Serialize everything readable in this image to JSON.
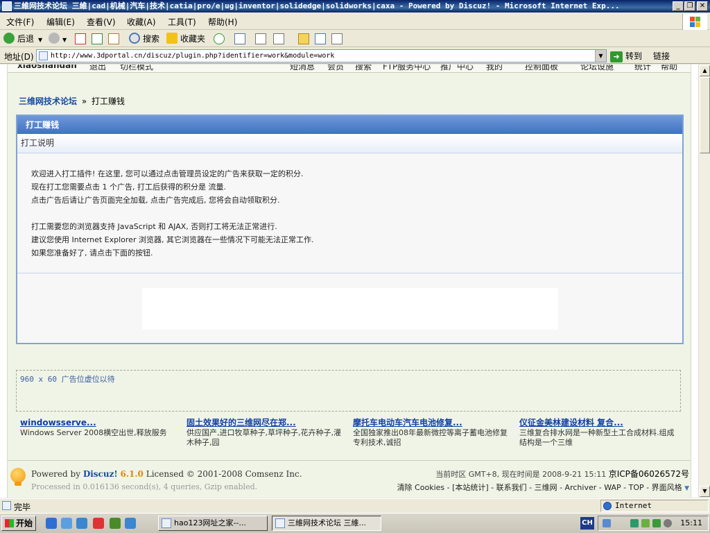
{
  "window": {
    "title": "三維网技术论坛 三維|cad|机械|汽车|技术|catia|pro/e|ug|inventor|solidedge|solidworks|caxa - Powered by Discuz! - Microsoft Internet Exp...",
    "minimize": "_",
    "maximize": "❐",
    "close": "✕"
  },
  "menu": [
    "文件(F)",
    "编辑(E)",
    "查看(V)",
    "收藏(A)",
    "工具(T)",
    "帮助(H)"
  ],
  "toolbar": {
    "back": "后退",
    "search": "搜索",
    "favorites": "收藏夹"
  },
  "address": {
    "label": "地址(D)",
    "url": "http://www.3dportal.cn/discuz/plugin.php?identifier=work&module=work",
    "go": "转到",
    "links": "链接"
  },
  "topnav": {
    "user": "xiaoshandan",
    "logout": "退出",
    "mode": "切栏模式",
    "items": [
      "短消息",
      "会员",
      "搜索",
      "FTP服务中心",
      "推广中心",
      "我的",
      "控制面板",
      "论坛设施",
      "统计",
      "帮助"
    ]
  },
  "breadcrumb": {
    "home": "三维网技术论坛",
    "sep": "»",
    "current": "打工赚钱"
  },
  "panel": {
    "title": "打工赚钱",
    "subtitle": "打工说明",
    "lines": [
      "欢迎进入打工插件! 在这里, 您可以通过点击管理员设定的广告来获取一定的积分.",
      "现在打工您需要点击 1 个广告, 打工后获得的积分是 流量.",
      "点击广告后请让广告页面完全加载, 点击广告完成后, 您将会自动领取积分.",
      "",
      "打工需要您的浏览器支持 JavaScript 和 AJAX, 否则打工将无法正常进行.",
      "建议您使用 Internet Explorer 浏览器, 其它浏览器在一些情况下可能无法正常工作.",
      "如果您准备好了, 请点击下面的按钮."
    ]
  },
  "banner_placeholder": "960 x 60 广告位虚位以待",
  "ads": [
    {
      "title": "windowsserve...",
      "desc": "Windows Server 2008横空出世,释放服务"
    },
    {
      "title": "固土效果好的三维网尽在郑...",
      "desc": "供应国产,进口牧草种子,草坪种子,花卉种子,灌木种子,园"
    },
    {
      "title": "摩托车电动车汽车电池修复...",
      "desc": "全国独家推出08年最新微控等离子蓄电池修复专利技术,诚招"
    },
    {
      "title": "仪征金美林建设材料 复合...",
      "desc": "三维复合排水网是一种新型土工合成材料.组成结构是一个三维"
    }
  ],
  "footer": {
    "powered_by": "Powered by",
    "brand": "Discuz!",
    "version": "6.1.0",
    "license": "Licensed © 2001-2008 Comsenz Inc.",
    "processed": "Processed in 0.016136 second(s), 4 queries, Gzip enabled.",
    "timezone": "当前时区 GMT+8, 现在时间是 2008-9-21 15:11",
    "icp": "京ICP备06026572号",
    "links": "清除 Cookies - [本站统计] - 联系我们 - 三维网 - Archiver - WAP - TOP - 界面风格"
  },
  "status": {
    "text": "完毕",
    "zone": "Internet"
  },
  "taskbar": {
    "start": "开始",
    "tasks": [
      "hao123网址之家--...",
      "三維网技术论坛 三維..."
    ],
    "lang": "CH",
    "clock": "15:11"
  },
  "colors": {
    "accent": "#3f73c2",
    "link": "#123fa6",
    "page_bg": "#f0f4e6"
  }
}
